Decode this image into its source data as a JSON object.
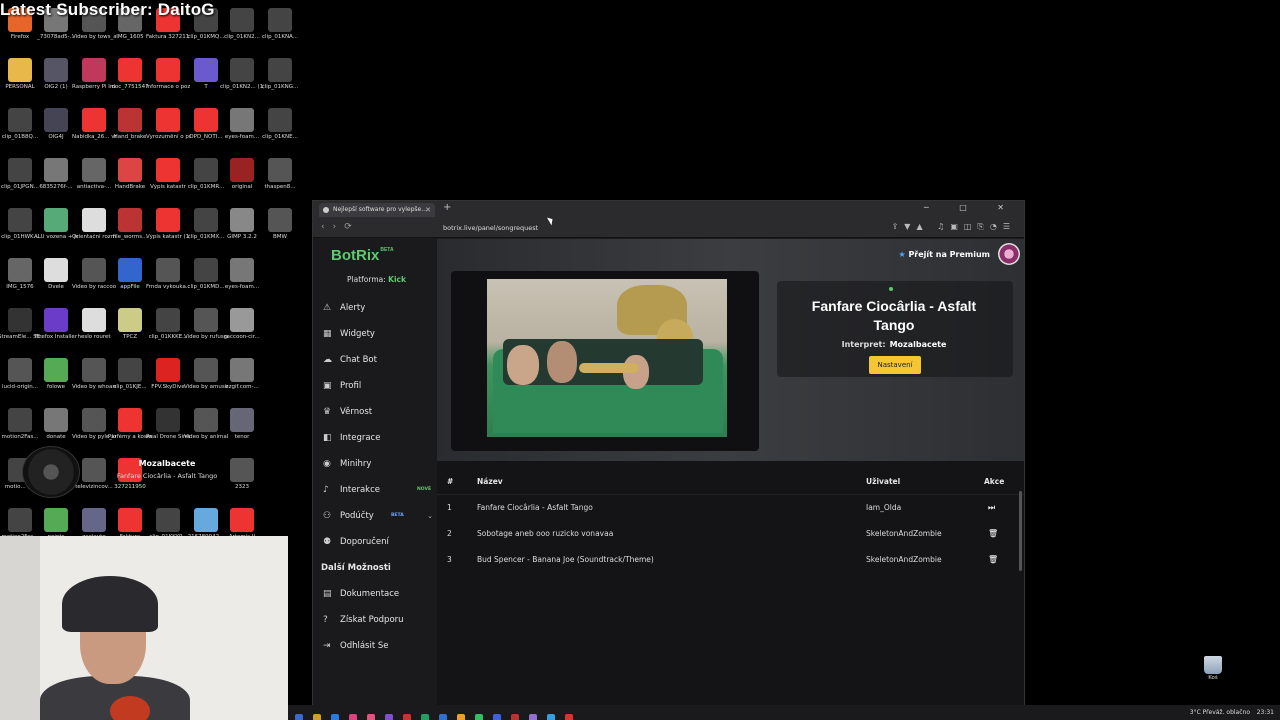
{
  "overlay": {
    "banner": "Latest Subscriber: DaitoG"
  },
  "desktop_icons": [
    {
      "label": "Firefox",
      "color": "#e8652a"
    },
    {
      "label": "_73078ad5-...",
      "color": "#777"
    },
    {
      "label": "Video by tows_and_t...",
      "color": "#555"
    },
    {
      "label": "IMG_1605",
      "color": "#666"
    },
    {
      "label": "Faktura 32721179...",
      "color": "#e33"
    },
    {
      "label": "clip_01KMQ...",
      "color": "#444"
    },
    {
      "label": "clip_01KN2...",
      "color": "#444"
    },
    {
      "label": "clip_01KNA...",
      "color": "#444"
    },
    {
      "label": "PERSONAL",
      "color": "#e8b84a"
    },
    {
      "label": "OIG2 (1)",
      "color": "#556"
    },
    {
      "label": "Raspberry Pi Imager",
      "color": "#c0395c"
    },
    {
      "label": "doc_7751547",
      "color": "#e33"
    },
    {
      "label": "Informace o pozemku ...",
      "color": "#e33"
    },
    {
      "label": "T",
      "color": "#6a5acd"
    },
    {
      "label": "clip_01KN2... (1)",
      "color": "#444"
    },
    {
      "label": "clip_01KNG...",
      "color": "#444"
    },
    {
      "label": "clip_01B8Q...",
      "color": "#444"
    },
    {
      "label": "OIG4J",
      "color": "#445"
    },
    {
      "label": "Nabídka_26... vrata se zvý...",
      "color": "#e33"
    },
    {
      "label": "Hand_brake",
      "color": "#b33"
    },
    {
      "label": "Vyrozumění o provede...",
      "color": "#e33"
    },
    {
      "label": "DPD_NOTI...",
      "color": "#e33"
    },
    {
      "label": "eyes-foam...",
      "color": "#777"
    },
    {
      "label": "clip_01KNE...",
      "color": "#444"
    },
    {
      "label": "clip_01JPGN...",
      "color": "#444"
    },
    {
      "label": "6835276f-...",
      "color": "#777"
    },
    {
      "label": "antiactiva-...",
      "color": "#666"
    },
    {
      "label": "HandBrake",
      "color": "#d44"
    },
    {
      "label": "Výpis katastr",
      "color": "#e33"
    },
    {
      "label": "clip_01KMR...",
      "color": "#444"
    },
    {
      "label": "original",
      "color": "#922"
    },
    {
      "label": "thaspen8...",
      "color": "#555"
    },
    {
      "label": "clip_01HWK...",
      "color": "#444"
    },
    {
      "label": "ALU vozena + jednostr...",
      "color": "#5a7"
    },
    {
      "label": "Orientační rozměry a ...",
      "color": "#ddd"
    },
    {
      "label": "file_worms...",
      "color": "#b33"
    },
    {
      "label": "Výpis katastr (1)",
      "color": "#e33"
    },
    {
      "label": "clip_01KMX...",
      "color": "#444"
    },
    {
      "label": "GIMP 3.2.2",
      "color": "#888"
    },
    {
      "label": "BMW",
      "color": "#555"
    },
    {
      "label": "IMG_1576",
      "color": "#666"
    },
    {
      "label": "Dvele",
      "color": "#ddd"
    },
    {
      "label": "Video by raccoon_dai...",
      "color": "#555"
    },
    {
      "label": "appFile",
      "color": "#36c"
    },
    {
      "label": "Frnda vykouka...",
      "color": "#555"
    },
    {
      "label": "clip_01KMD...",
      "color": "#444"
    },
    {
      "label": "eyes-foam...",
      "color": "#777"
    },
    {
      "label": "",
      "color": "#000"
    },
    {
      "label": "StreamEle... SE.Live",
      "color": "#333"
    },
    {
      "label": "Firefox Installer",
      "color": "#6a3cc8"
    },
    {
      "label": "heslo rouret",
      "color": "#ddd"
    },
    {
      "label": "TPCZ",
      "color": "#cc8"
    },
    {
      "label": "clip_01KKKE...",
      "color": "#444"
    },
    {
      "label": "Video by rufusgood...",
      "color": "#555"
    },
    {
      "label": "raccoon-cir...",
      "color": "#999"
    },
    {
      "label": "",
      "color": "#000"
    },
    {
      "label": "lucid-origin...",
      "color": "#555"
    },
    {
      "label": "folowe",
      "color": "#5a5"
    },
    {
      "label": "Video by whoareyo...",
      "color": "#555"
    },
    {
      "label": "clip_01KJE...",
      "color": "#444"
    },
    {
      "label": "FPV.SkyDive",
      "color": "#d22"
    },
    {
      "label": "Video by amusingsa...",
      "color": "#555"
    },
    {
      "label": "ezgif.com-...",
      "color": "#777"
    },
    {
      "label": "",
      "color": "#000"
    },
    {
      "label": "motion2Fas...",
      "color": "#444"
    },
    {
      "label": "donate",
      "color": "#777"
    },
    {
      "label": "Video by pyle_keisha",
      "color": "#555"
    },
    {
      "label": "Parfémy a kosmetika...",
      "color": "#e33"
    },
    {
      "label": "Real Drone Simulator",
      "color": "#333"
    },
    {
      "label": "Video by animalsaida",
      "color": "#555"
    },
    {
      "label": "tenor",
      "color": "#667"
    },
    {
      "label": "",
      "color": "#000"
    },
    {
      "label": "motio... (1)",
      "color": "#444"
    },
    {
      "label": "",
      "color": "#000"
    },
    {
      "label": "televizincov...",
      "color": "#555"
    },
    {
      "label": "327211950",
      "color": "#e33"
    },
    {
      "label": "",
      "color": "#000"
    },
    {
      "label": "",
      "color": "#000"
    },
    {
      "label": "2323",
      "color": "#555"
    },
    {
      "label": "",
      "color": "#000"
    },
    {
      "label": "motion2Fas...",
      "color": "#444"
    },
    {
      "label": "points",
      "color": "#5a5"
    },
    {
      "label": "zastavte",
      "color": "#668"
    },
    {
      "label": "Faktura",
      "color": "#e33"
    },
    {
      "label": "clip_01KKYP...",
      "color": "#444"
    },
    {
      "label": "216789042...",
      "color": "#6ad"
    },
    {
      "label": "Artemis II",
      "color": "#e33"
    },
    {
      "label": "",
      "color": "#000"
    }
  ],
  "now_playing": {
    "artist": "Mozalbacete",
    "track": "Fanfare Ciocârlia - Asfalt Tango"
  },
  "browser": {
    "tab_title": "Nejlepší software pro vylepše...",
    "url": "botrix.live/panel/songrequest",
    "window_controls": "─ □ ✕"
  },
  "app": {
    "logo": "BotRix",
    "logo_badge": "BETA",
    "platform_label": "Platforma:",
    "platform_value": "Kick",
    "premium_label": "Přejít na Premium",
    "menu": [
      {
        "label": "Alerty",
        "icon": "⚠",
        "badge": ""
      },
      {
        "label": "Widgety",
        "icon": "▦",
        "badge": ""
      },
      {
        "label": "Chat Bot",
        "icon": "☁",
        "badge": ""
      },
      {
        "label": "Profil",
        "icon": "▣",
        "badge": ""
      },
      {
        "label": "Věrnost",
        "icon": "♛",
        "badge": ""
      },
      {
        "label": "Integrace",
        "icon": "◧",
        "badge": ""
      },
      {
        "label": "Minihry",
        "icon": "◉",
        "badge": ""
      },
      {
        "label": "Interakce",
        "icon": "♪",
        "badge": "NOVÉ"
      },
      {
        "label": "Podúčty",
        "icon": "⚇",
        "badge": "BETA"
      },
      {
        "label": "Doporučení",
        "icon": "⚉",
        "badge": ""
      }
    ],
    "section_title": "Další Možnosti",
    "menu2": [
      {
        "label": "Dokumentace",
        "icon": "▤"
      },
      {
        "label": "Získat Podporu",
        "icon": "?"
      },
      {
        "label": "Odhlásit Se",
        "icon": "⇥"
      }
    ],
    "current_song": {
      "title": "Fanfare Ciocârlia - Asfalt Tango",
      "artist_label": "Interpret:",
      "artist": "Mozalbacete",
      "settings_button": "Nastavení"
    },
    "table": {
      "headers": [
        "#",
        "Název",
        "Uživatel",
        "Akce"
      ],
      "rows": [
        {
          "num": "1",
          "name": "Fanfare Ciocârlia - Asfalt Tango",
          "user": "Iam_Olda",
          "action_icon": "⏭"
        },
        {
          "num": "2",
          "name": "Sobotage aneb ooo ruzicko vonavaa",
          "user": "SkeletonAndZombie",
          "action_icon": "🗑"
        },
        {
          "num": "3",
          "name": "Bud Spencer - Banana Joe (Soundtrack/Theme)",
          "user": "SkeletonAndZombie",
          "action_icon": "🗑"
        }
      ]
    }
  },
  "recycle_bin": "Koš",
  "taskbar": {
    "weather": "3°C  Převáž. oblačno",
    "clock": "23:31",
    "colors": [
      "#3a6ad0",
      "#d0a020",
      "#2a7ae0",
      "#e04080",
      "#e85080",
      "#8050d0",
      "#d03030",
      "#20a060",
      "#3070d0",
      "#f0a020",
      "#30c060",
      "#4060e0",
      "#c03030",
      "#9070d0",
      "#30a0e0",
      "#e03030"
    ]
  }
}
